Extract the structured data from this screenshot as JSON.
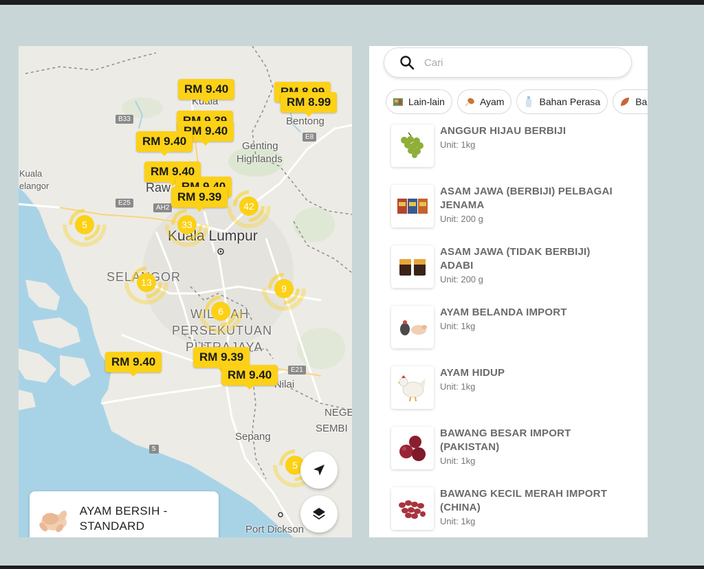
{
  "map": {
    "labels": {
      "kuala": "Kuala",
      "bentong": "Bentong",
      "genting": "Genting",
      "highlands": "Highlands",
      "kuala_selangor_1": "Kuala",
      "kuala_selangor_2": "elangor",
      "rawang": "Raw",
      "kuala_lumpur": "Kuala Lumpur",
      "selangor": "SELANGOR",
      "wilayah": "WILAYAH",
      "persekutuan": "PERSEKUTUAN",
      "putrajaya": "PUTRAJAYA",
      "nilai": "Nilai",
      "negeri": "NEGE",
      "sembilan": "SEMBI",
      "sepang": "Sepang",
      "port_dickson": "Port Dickson"
    },
    "roads": {
      "b33": "B33",
      "e8": "E8",
      "e25": "E25",
      "ah2": "AH2",
      "e21": "E21",
      "five": "5"
    },
    "price_tags": [
      "RM 9.40",
      "RM 8.99",
      "RM 8.99",
      "RM 9.39",
      "RM 9.40",
      "RM 9.40",
      "RM 9.40",
      "RM 9.40",
      "RM 9.39",
      "RM 9.40",
      "RM 9.39",
      "RM 9.40"
    ],
    "clusters": [
      "5",
      "33",
      "42",
      "13",
      "9",
      "6",
      "5"
    ],
    "selected_product": "AYAM BERSIH - STANDARD"
  },
  "search": {
    "placeholder": "Cari",
    "value": ""
  },
  "categories": [
    {
      "label": "Lain-lain",
      "icon": "box-icon"
    },
    {
      "label": "Ayam",
      "icon": "drumstick-icon"
    },
    {
      "label": "Bahan Perasa",
      "icon": "bottle-icon"
    },
    {
      "label": "Bara",
      "icon": "leaf-icon"
    }
  ],
  "items": [
    {
      "name": "ANGGUR HIJAU BERBIJI",
      "unit": "Unit: 1kg",
      "icon": "grapes-icon"
    },
    {
      "name": "ASAM JAWA (BERBIJI) PELBAGAI JENAMA",
      "unit": "Unit: 200 g",
      "icon": "tamarind-pack-icon"
    },
    {
      "name": "ASAM JAWA (TIDAK BERBIJI) ADABI",
      "unit": "Unit: 200 g",
      "icon": "tamarind-jar-icon"
    },
    {
      "name": "AYAM BELANDA IMPORT",
      "unit": "Unit: 1kg",
      "icon": "turkey-icon"
    },
    {
      "name": "AYAM HIDUP",
      "unit": "Unit: 1kg",
      "icon": "live-chicken-icon"
    },
    {
      "name": "BAWANG BESAR IMPORT (PAKISTAN)",
      "unit": "Unit: 1kg",
      "icon": "onion-icon"
    },
    {
      "name": "BAWANG KECIL MERAH IMPORT (CHINA)",
      "unit": "Unit: 1kg",
      "icon": "shallot-icon"
    }
  ],
  "colors": {
    "accent": "#fcd116",
    "water": "#a8d3e6",
    "land": "#ecebe6"
  }
}
